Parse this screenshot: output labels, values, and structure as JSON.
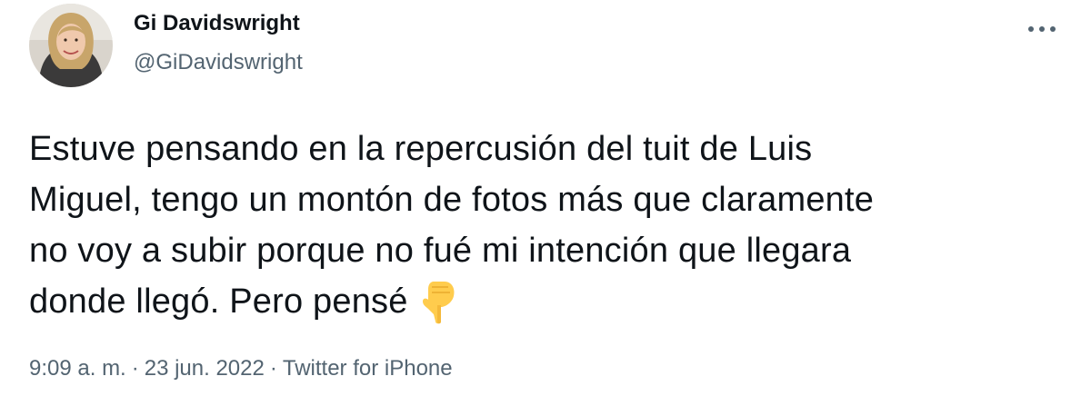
{
  "author": {
    "display_name": "Gi Davidswright",
    "handle": "@GiDavidswright"
  },
  "tweet": {
    "text_lines": [
      "Estuve pensando en la repercusión del tuit de Luis",
      "Miguel, tengo un montón de fotos más que claramente",
      "no voy a subir porque no fué mi intención que llegara",
      "donde llegó. Pero pensé"
    ],
    "emoji": "backhand-index-pointing-down-icon"
  },
  "meta": {
    "time": "9:09 a. m.",
    "separator": "·",
    "date": "23 jun. 2022",
    "source": "Twitter for iPhone"
  },
  "colors": {
    "text_primary": "#0f1419",
    "text_secondary": "#536471",
    "background": "#ffffff"
  }
}
